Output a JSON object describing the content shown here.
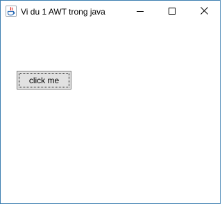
{
  "window": {
    "title": "Vi du 1 AWT trong java",
    "app_icon": "java-icon",
    "controls": {
      "minimize_icon": "minimize-icon",
      "maximize_icon": "maximize-icon",
      "close_icon": "close-icon"
    },
    "border_color": "#3c7fb1"
  },
  "content": {
    "button_label": "click me"
  }
}
